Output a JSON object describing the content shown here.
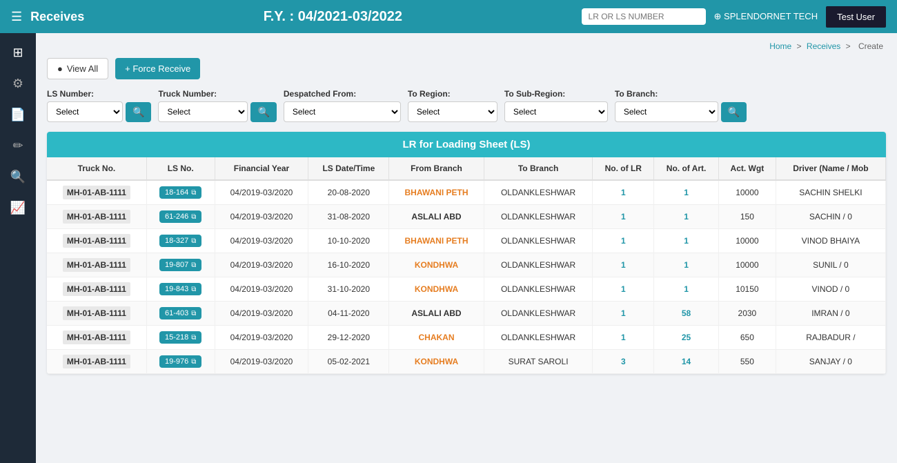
{
  "navbar": {
    "menu_icon": "☰",
    "title": "Receives",
    "fy_label": "F.Y. : 04/2021-03/2022",
    "search_placeholder": "LR OR LS NUMBER",
    "company_prefix": "⊕",
    "company_name": "SPLENDORNET TECH",
    "user_name": "Test User"
  },
  "breadcrumb": {
    "home": "Home",
    "sep1": ">",
    "receives": "Receives",
    "sep2": ">",
    "create": "Create"
  },
  "toolbar": {
    "view_all_label": "View All",
    "force_receive_label": "+ Force Receive"
  },
  "filters": {
    "ls_number_label": "LS Number:",
    "ls_number_placeholder": "Select",
    "truck_number_label": "Truck Number:",
    "truck_number_placeholder": "Select",
    "despatched_from_label": "Despatched From:",
    "despatched_from_placeholder": "Select",
    "to_region_label": "To Region:",
    "to_region_placeholder": "Select",
    "to_subregion_label": "To Sub-Region:",
    "to_subregion_placeholder": "Select",
    "to_branch_label": "To Branch:",
    "to_branch_placeholder": "Select"
  },
  "table": {
    "header": "LR for Loading Sheet (LS)",
    "columns": [
      "Truck No.",
      "LS No.",
      "Financial Year",
      "LS Date/Time",
      "From Branch",
      "To Branch",
      "No. of LR",
      "No. of Art.",
      "Act. Wgt",
      "Driver (Name / Mob"
    ],
    "rows": [
      {
        "truck_no": "MH-01-AB-1111",
        "ls_no": "18-164",
        "financial_year": "04/2019-03/2020",
        "ls_datetime": "20-08-2020",
        "from_branch": "BHAWANI PETH",
        "to_branch": "OLDANKLESHWAR",
        "no_of_lr": "1",
        "no_of_art": "1",
        "act_wgt": "10000",
        "driver": "SACHIN SHELKI"
      },
      {
        "truck_no": "MH-01-AB-1111",
        "ls_no": "61-246",
        "financial_year": "04/2019-03/2020",
        "ls_datetime": "31-08-2020",
        "from_branch": "ASLALI ABD",
        "to_branch": "OLDANKLESHWAR",
        "no_of_lr": "1",
        "no_of_art": "1",
        "act_wgt": "150",
        "driver": "SACHIN / 0"
      },
      {
        "truck_no": "MH-01-AB-1111",
        "ls_no": "18-327",
        "financial_year": "04/2019-03/2020",
        "ls_datetime": "10-10-2020",
        "from_branch": "BHAWANI PETH",
        "to_branch": "OLDANKLESHWAR",
        "no_of_lr": "1",
        "no_of_art": "1",
        "act_wgt": "10000",
        "driver": "VINOD BHAIYA"
      },
      {
        "truck_no": "MH-01-AB-1111",
        "ls_no": "19-807",
        "financial_year": "04/2019-03/2020",
        "ls_datetime": "16-10-2020",
        "from_branch": "KONDHWA",
        "to_branch": "OLDANKLESHWAR",
        "no_of_lr": "1",
        "no_of_art": "1",
        "act_wgt": "10000",
        "driver": "SUNIL / 0"
      },
      {
        "truck_no": "MH-01-AB-1111",
        "ls_no": "19-843",
        "financial_year": "04/2019-03/2020",
        "ls_datetime": "31-10-2020",
        "from_branch": "KONDHWA",
        "to_branch": "OLDANKLESHWAR",
        "no_of_lr": "1",
        "no_of_art": "1",
        "act_wgt": "10150",
        "driver": "VINOD / 0"
      },
      {
        "truck_no": "MH-01-AB-1111",
        "ls_no": "61-403",
        "financial_year": "04/2019-03/2020",
        "ls_datetime": "04-11-2020",
        "from_branch": "ASLALI ABD",
        "to_branch": "OLDANKLESHWAR",
        "no_of_lr": "1",
        "no_of_art": "58",
        "act_wgt": "2030",
        "driver": "IMRAN / 0"
      },
      {
        "truck_no": "MH-01-AB-1111",
        "ls_no": "15-218",
        "financial_year": "04/2019-03/2020",
        "ls_datetime": "29-12-2020",
        "from_branch": "CHAKAN",
        "to_branch": "OLDANKLESHWAR",
        "no_of_lr": "1",
        "no_of_art": "25",
        "act_wgt": "650",
        "driver": "RAJBADUR /"
      },
      {
        "truck_no": "MH-01-AB-1111",
        "ls_no": "19-976",
        "financial_year": "04/2019-03/2020",
        "ls_datetime": "05-02-2021",
        "from_branch": "KONDHWA",
        "to_branch": "SURAT SAROLI",
        "no_of_lr": "3",
        "no_of_art": "14",
        "act_wgt": "550",
        "driver": "SANJAY / 0"
      }
    ]
  },
  "sidebar": {
    "icons": [
      {
        "name": "grid-icon",
        "glyph": "⊞"
      },
      {
        "name": "settings-icon",
        "glyph": "⚙"
      },
      {
        "name": "document-icon",
        "glyph": "📄"
      },
      {
        "name": "edit-icon",
        "glyph": "✏"
      },
      {
        "name": "search-icon",
        "glyph": "🔍"
      },
      {
        "name": "chart-icon",
        "glyph": "📈"
      }
    ]
  }
}
